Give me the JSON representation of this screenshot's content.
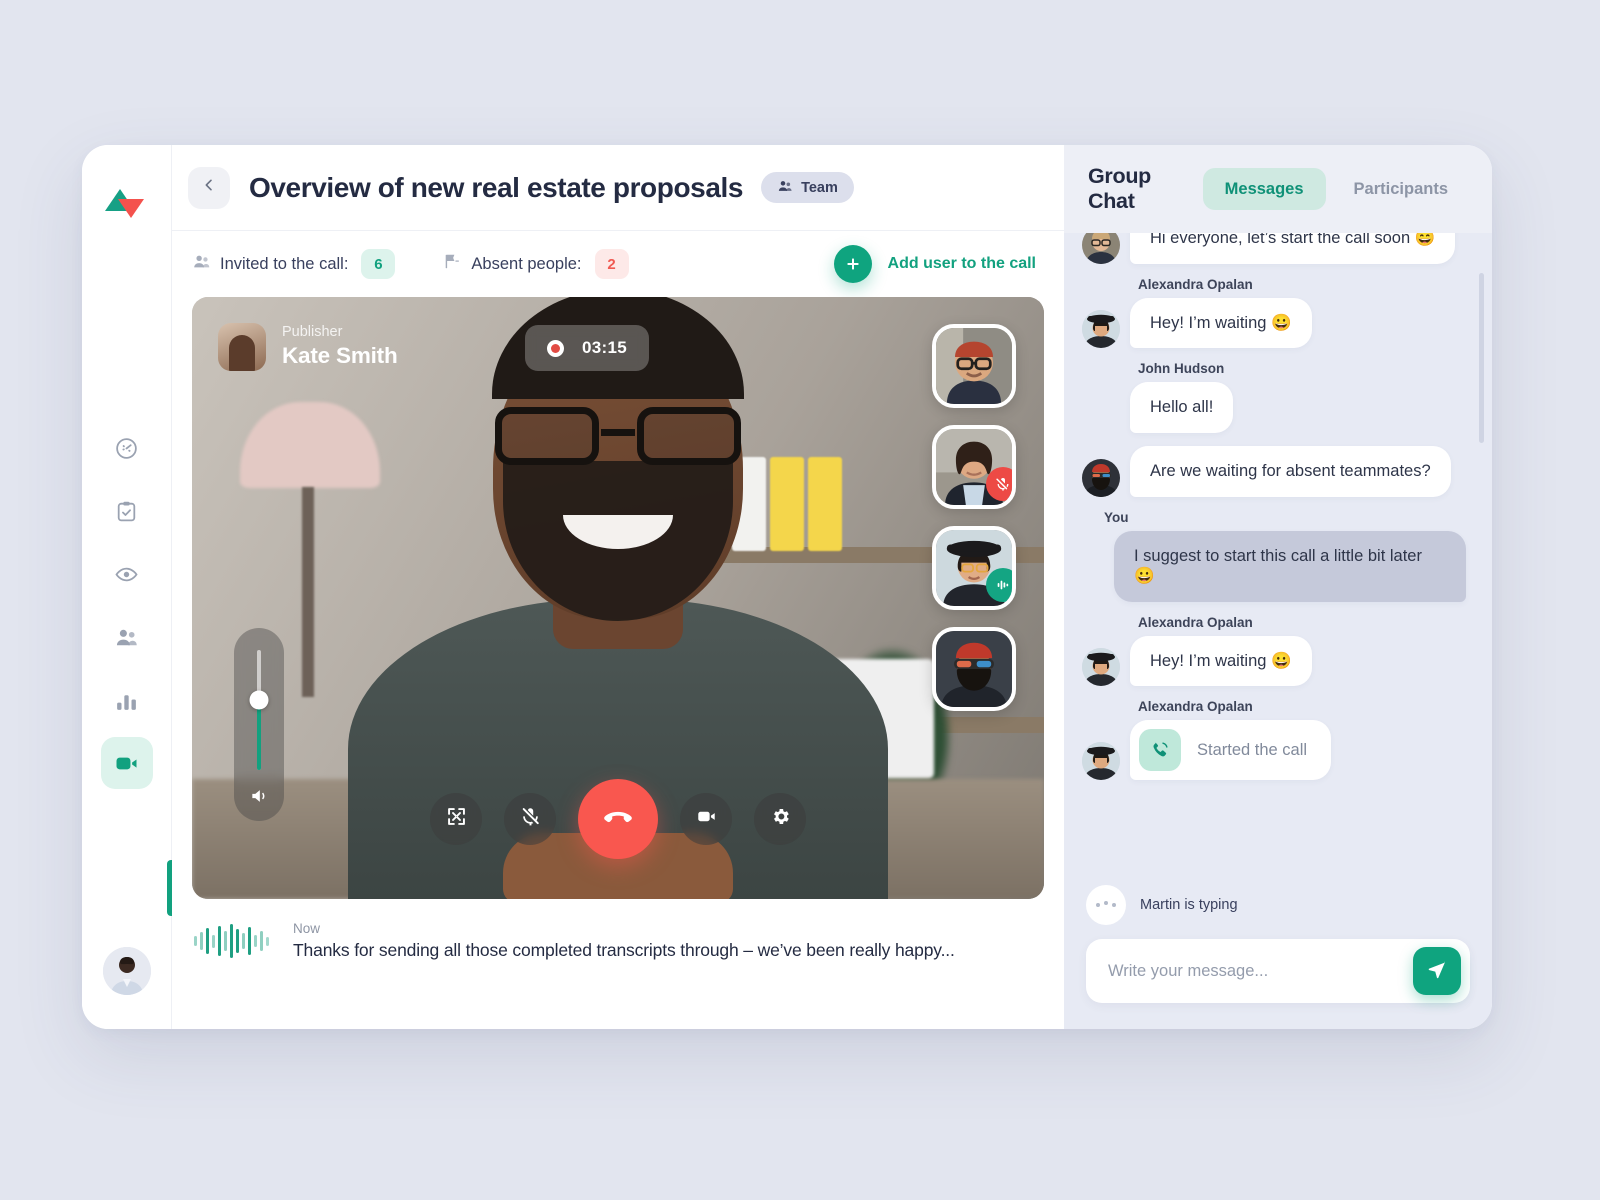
{
  "sidebar": {
    "logo_name": "logo-triangles",
    "items": [
      {
        "icon": "dashboard-icon",
        "label": "Dashboard",
        "active": false
      },
      {
        "icon": "clipboard-check-icon",
        "label": "Tasks",
        "active": false
      },
      {
        "icon": "eye-icon",
        "label": "Watch",
        "active": false
      },
      {
        "icon": "people-icon",
        "label": "Contacts",
        "active": false
      },
      {
        "icon": "bar-chart-icon",
        "label": "Statistics",
        "active": false
      },
      {
        "icon": "video-camera-icon",
        "label": "Video call",
        "active": true
      }
    ],
    "avatar_name": "user-avatar"
  },
  "header": {
    "back_icon": "chevron-left-icon",
    "title": "Overview of new real estate proposals",
    "team_chip": {
      "icon": "team-icon",
      "label": "Team"
    }
  },
  "meta": {
    "invited_icon": "people-icon",
    "invited_label": "Invited to the call:",
    "invited_count": "6",
    "absent_icon": "flag-icon",
    "absent_label": "Absent people:",
    "absent_count": "2",
    "add_user_icon": "plus-icon",
    "add_user_label": "Add user to the call"
  },
  "stage": {
    "publisher_role": "Publisher",
    "publisher_name": "Kate Smith",
    "record_icon": "record-dot-icon",
    "timer": "03:15",
    "volume": {
      "icon": "speaker-icon",
      "level": 58
    },
    "thumbnails": [
      {
        "name": "participant-thumb-1",
        "badge": null
      },
      {
        "name": "participant-thumb-2",
        "badge": "mic-muted-icon"
      },
      {
        "name": "participant-thumb-3",
        "badge": "speaking-icon"
      },
      {
        "name": "participant-thumb-4",
        "badge": null
      }
    ],
    "controls": [
      {
        "name": "fullscreen-button",
        "icon": "expand-icon"
      },
      {
        "name": "mic-mute-button",
        "icon": "mic-off-icon"
      },
      {
        "name": "hangup-button",
        "icon": "phone-hangup-icon"
      },
      {
        "name": "camera-button",
        "icon": "video-camera-icon"
      },
      {
        "name": "settings-button",
        "icon": "gear-icon"
      }
    ]
  },
  "transcript": {
    "wave_icon": "audio-waveform-icon",
    "time": "Now",
    "text": "Thanks for sending all those completed transcripts through – we’ve been really happy..."
  },
  "chat": {
    "title": "Group Chat",
    "tabs": [
      {
        "label": "Messages",
        "active": true
      },
      {
        "label": "Participants",
        "active": false
      }
    ],
    "messages": [
      {
        "sender": "",
        "text": "Hi everyone, let’s start the call soon 😄",
        "self": false,
        "avatar": "avatar-john",
        "cut": true,
        "kind": "text"
      },
      {
        "sender": "Alexandra Opalan",
        "text": "Hey! I’m waiting 😀",
        "self": false,
        "avatar": "avatar-alexandra",
        "kind": "text"
      },
      {
        "sender": "John Hudson",
        "text": "Hello all!",
        "self": false,
        "avatar": null,
        "kind": "text"
      },
      {
        "sender": "",
        "text": "Are we waiting for absent teammates?",
        "self": false,
        "avatar": "avatar-martin",
        "kind": "text"
      },
      {
        "sender": "You",
        "text": "I suggest to start this call a little bit later 😀",
        "self": true,
        "avatar": null,
        "kind": "text"
      },
      {
        "sender": "Alexandra Opalan",
        "text": "Hey! I’m waiting 😀",
        "self": false,
        "avatar": "avatar-alexandra",
        "kind": "text"
      },
      {
        "sender": "Alexandra Opalan",
        "text": "Started the call",
        "self": false,
        "avatar": "avatar-alexandra",
        "kind": "call",
        "icon": "phone-call-icon"
      }
    ],
    "typing": {
      "icon": "typing-dots-icon",
      "text": "Martin is typing"
    },
    "composer": {
      "placeholder": "Write your message...",
      "value": "",
      "send_icon": "send-icon"
    }
  },
  "colors": {
    "accent_green": "#0fa47f",
    "accent_green_light": "#ddf3ec",
    "danger_red": "#f9574f",
    "page_bg": "#e2e5ef",
    "chat_bg": "#e7eaf4",
    "text_dark": "#242b42"
  }
}
